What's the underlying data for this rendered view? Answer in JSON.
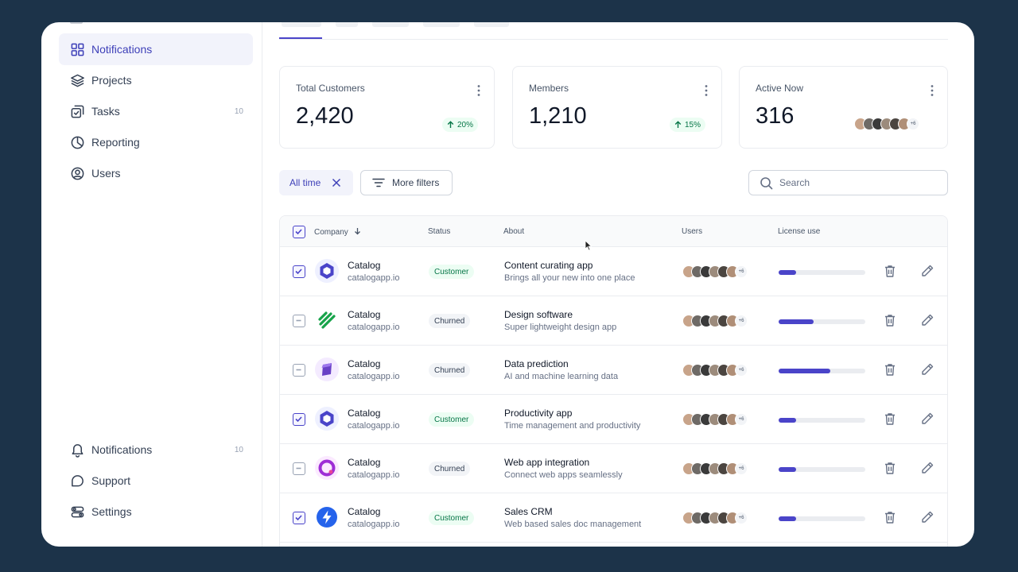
{
  "sidebar": {
    "top_items": [
      {
        "label": "Notifications",
        "icon": "grid-icon",
        "active": true
      },
      {
        "label": "Projects",
        "icon": "layers-icon"
      },
      {
        "label": "Tasks",
        "icon": "check-square-icon",
        "badge": "10"
      },
      {
        "label": "Reporting",
        "icon": "pie-chart-icon"
      },
      {
        "label": "Users",
        "icon": "user-circle-icon"
      }
    ],
    "bottom_items": [
      {
        "label": "Notifications",
        "icon": "bell-icon",
        "badge": "10"
      },
      {
        "label": "Support",
        "icon": "life-buoy-icon"
      },
      {
        "label": "Settings",
        "icon": "settings-icon"
      }
    ]
  },
  "stats": [
    {
      "label": "Total Customers",
      "value": "2,420",
      "trend": "20%"
    },
    {
      "label": "Members",
      "value": "1,210",
      "trend": "15%"
    },
    {
      "label": "Active Now",
      "value": "316",
      "avatars_more": "+6"
    }
  ],
  "filters": {
    "chip_label": "All time",
    "more_filters_label": "More filters",
    "search_placeholder": "Search"
  },
  "table": {
    "columns": {
      "company": "Company",
      "status": "Status",
      "about": "About",
      "users": "Users",
      "license": "License use"
    },
    "rows": [
      {
        "checked": true,
        "name": "Catalog",
        "domain": "catalogapp.io",
        "status": "Customer",
        "status_kind": "customer",
        "about_title": "Content curating app",
        "about_sub": "Brings all your new into one place",
        "users_more": "+6",
        "license": 0.2,
        "logo": "hexagon-logo",
        "logo_color": "#4a44c9"
      },
      {
        "checked": false,
        "name": "Catalog",
        "domain": "catalogapp.io",
        "status": "Churned",
        "status_kind": "churned",
        "about_title": "Design software",
        "about_sub": "Super lightweight design app",
        "users_more": "+6",
        "license": 0.4,
        "logo": "stripes-logo",
        "logo_color": "#17a34a"
      },
      {
        "checked": false,
        "name": "Catalog",
        "domain": "catalogapp.io",
        "status": "Churned",
        "status_kind": "churned",
        "about_title": "Data prediction",
        "about_sub": "AI and machine learning data",
        "users_more": "+6",
        "license": 0.6,
        "logo": "cube-logo",
        "logo_color": "#6941c6"
      },
      {
        "checked": true,
        "name": "Catalog",
        "domain": "catalogapp.io",
        "status": "Customer",
        "status_kind": "customer",
        "about_title": "Productivity app",
        "about_sub": "Time management and productivity",
        "users_more": "+6",
        "license": 0.2,
        "logo": "hexagon-logo",
        "logo_color": "#4a44c9"
      },
      {
        "checked": false,
        "name": "Catalog",
        "domain": "catalogapp.io",
        "status": "Churned",
        "status_kind": "churned",
        "about_title": "Web app integration",
        "about_sub": "Connect web apps seamlessly",
        "users_more": "+6",
        "license": 0.2,
        "logo": "ring-logo",
        "logo_color": "#9e2dd6"
      },
      {
        "checked": true,
        "name": "Catalog",
        "domain": "catalogapp.io",
        "status": "Customer",
        "status_kind": "customer",
        "about_title": "Sales CRM",
        "about_sub": "Web based sales doc management",
        "users_more": "+6",
        "license": 0.2,
        "logo": "bolt-logo",
        "logo_color": "#2563eb"
      }
    ]
  },
  "colors": {
    "accent": "#4a44c9",
    "success": "#067647",
    "background": "#1c3349"
  }
}
